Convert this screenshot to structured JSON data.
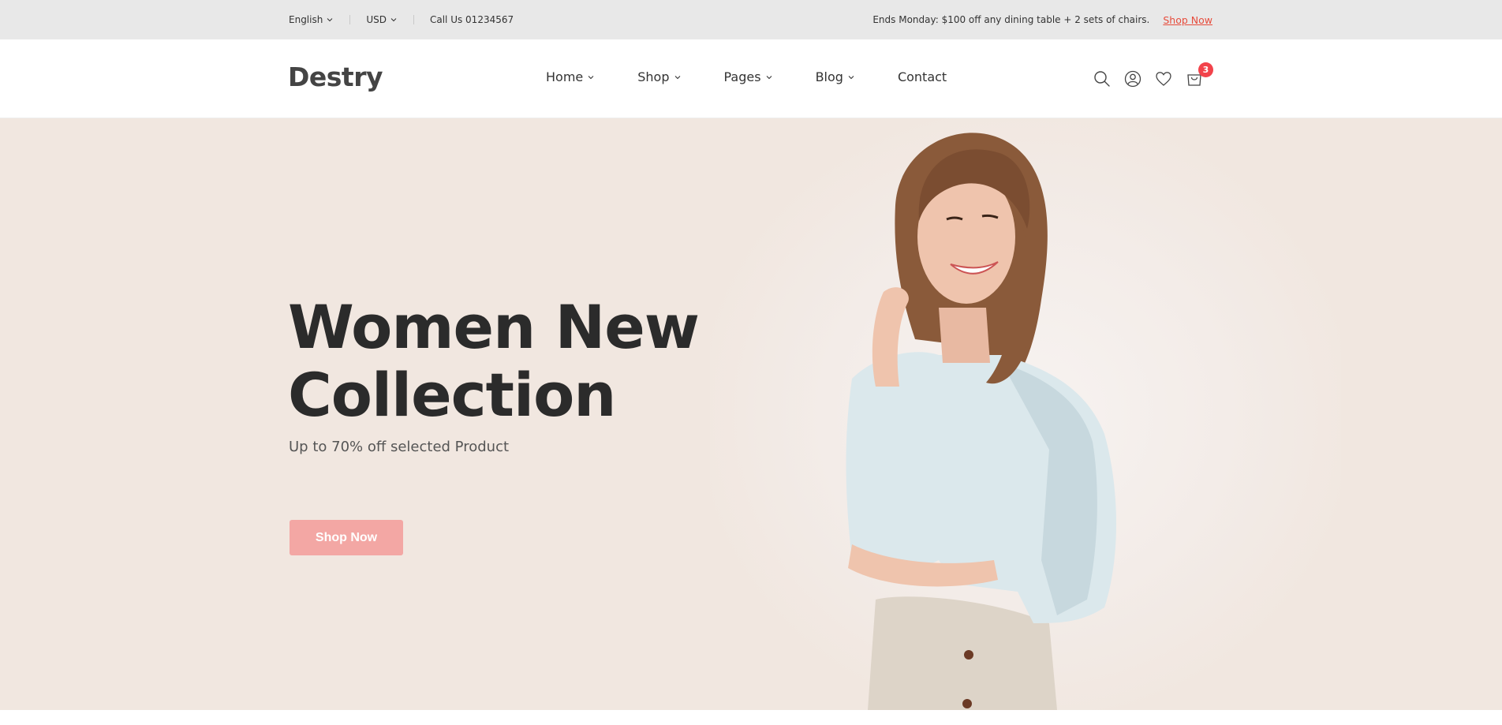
{
  "topbar": {
    "language": "English",
    "currency": "USD",
    "phone": "Call Us 01234567",
    "promo": "Ends Monday: $100 off any dining table + 2 sets of chairs.",
    "promo_link": "Shop Now"
  },
  "header": {
    "logo": "Destry",
    "nav": [
      {
        "label": "Home",
        "dropdown": true
      },
      {
        "label": "Shop",
        "dropdown": true
      },
      {
        "label": "Pages",
        "dropdown": true
      },
      {
        "label": "Blog",
        "dropdown": true
      },
      {
        "label": "Contact",
        "dropdown": false
      }
    ],
    "icons": [
      "search-icon",
      "user-icon",
      "heart-icon",
      "cart-icon"
    ],
    "cart_count": "3"
  },
  "hero": {
    "title_line1": "Women New",
    "title_line2": "Collection",
    "subtitle": "Up to 70% off selected Product",
    "button": "Shop Now"
  },
  "colors": {
    "accent": "#f2434b",
    "button": "#f3a7a4",
    "hero_bg": "#f1e7e0",
    "topbar_bg": "#e8e8e8"
  }
}
